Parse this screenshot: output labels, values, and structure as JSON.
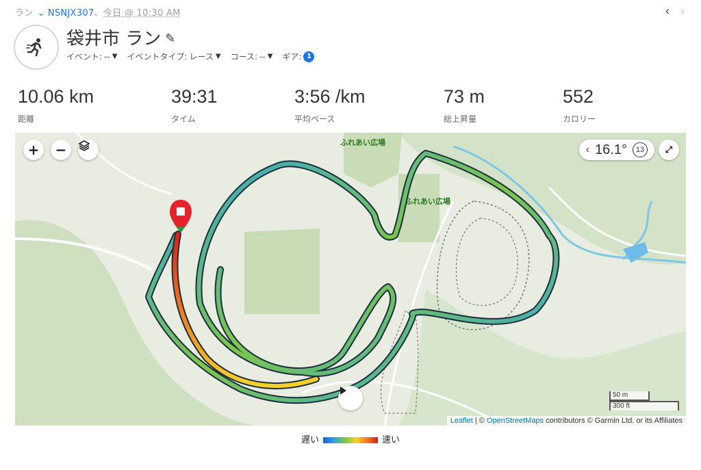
{
  "breadcrumb": {
    "activity_type": "ラン",
    "device": "NSNJX307",
    "sep": "、",
    "datetime": "今日 @ 10:30 AM"
  },
  "nav": {
    "prev_icon": "chevron-left-icon",
    "next_icon": "chevron-right-icon"
  },
  "activity": {
    "title": "袋井市 ラン",
    "icon": "running-person-icon",
    "edit_icon": "pencil-icon",
    "meta": {
      "event_label": "イベント:",
      "event_value": "--",
      "event_type_label": "イベントタイプ:",
      "event_type_value": "レース",
      "course_label": "コース:",
      "course_value": "--",
      "gear_label": "ギア:",
      "gear_count": "1"
    }
  },
  "stats": [
    {
      "value": "10.06 km",
      "label": "距離"
    },
    {
      "value": "39:31",
      "label": "タイム"
    },
    {
      "value": "3:56 /km",
      "label": "平均ペース"
    },
    {
      "value": "73 m",
      "label": "総上昇量"
    },
    {
      "value": "552",
      "label": "カロリー"
    }
  ],
  "map": {
    "zoom_in": "+",
    "zoom_out": "−",
    "layers_icon": "layers-icon",
    "temperature": "16.1°",
    "weather_badge": "13",
    "expand_icon": "expand-icon",
    "place_labels": [
      "ふれあい広場",
      "ふれあい広場"
    ],
    "scale_metric": "50 m",
    "scale_imperial": "300 ft",
    "attribution": {
      "leaflet": "Leaflet",
      "sep": " | © ",
      "osm": "OpenStreetMaps",
      "rest": " contributors © Garmin Ltd. or its Affiliates"
    },
    "play_icon": "play-icon"
  },
  "legend": {
    "slow": "遅い",
    "fast": "速い"
  },
  "colors": {
    "accent": "#1a73e8",
    "route_slow": "#1e64d2",
    "route_mid": "#7cc64a",
    "route_fast": "#d8201a"
  }
}
